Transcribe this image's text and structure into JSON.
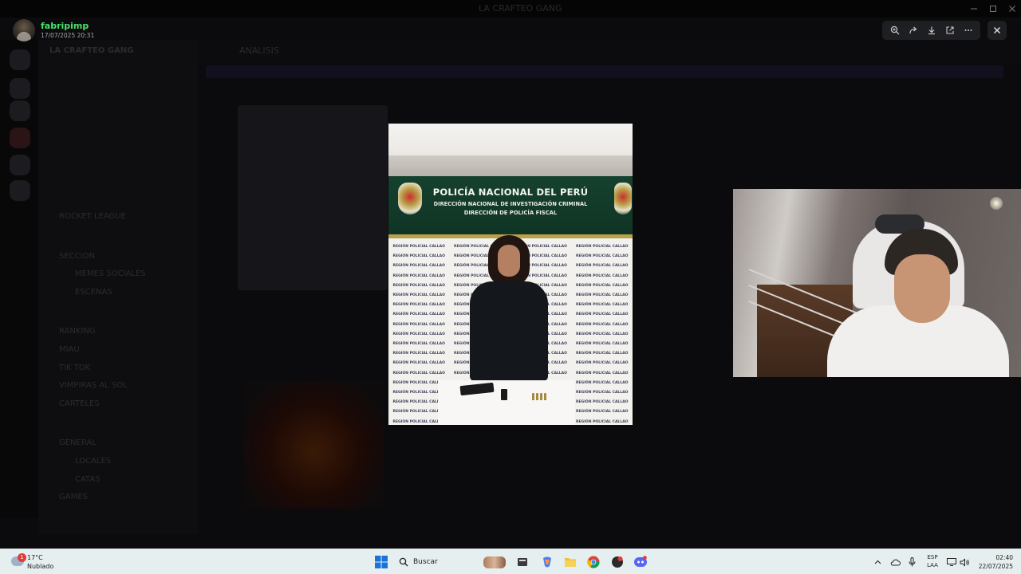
{
  "background_app": {
    "window_title": "LA CRAFTEO GANG",
    "server_name": "LA CRAFTEO GANG",
    "channel_header": "ANALISIS",
    "channels": [
      "ROCKET LEAGUE",
      "SECCION",
      "MEMES SOCIALES",
      "ESCENAS",
      "RANKING",
      "MIAU",
      "TIK TOK",
      "VIMPIRAS AL SOL",
      "CARTELES",
      "GENERAL",
      "LOCALES",
      "CATAS",
      "GAMES"
    ]
  },
  "viewer": {
    "username": "fabripimp",
    "timestamp": "17/07/2025 20:31",
    "toolbar": {
      "zoom_icon": "zoom-in-icon",
      "forward_icon": "forward-icon",
      "download_icon": "download-icon",
      "open_icon": "open-external-icon",
      "more_icon": "more-icon",
      "close_icon": "close-icon"
    }
  },
  "photo": {
    "banner_title": "POLICÍA NACIONAL DEL PERÚ",
    "banner_line2": "DIRECCIÓN NACIONAL DE INVESTIGACIÓN CRIMINAL",
    "banner_line3": "DIRECCIÓN DE POLICÍA FISCAL",
    "backdrop_text": "REGIÓN POLICIAL CALLAO"
  },
  "taskbar": {
    "weather": {
      "temp": "17°C",
      "condition": "Nublado",
      "alert_count": "1"
    },
    "search_placeholder": "Buscar",
    "language": {
      "line1": "ESP",
      "line2": "LAA"
    },
    "clock": {
      "time": "02:40",
      "date": "22/07/2025"
    },
    "apps": [
      "windows-start",
      "search",
      "file-explorer-app",
      "copilot",
      "folder",
      "chrome",
      "app-red",
      "discord"
    ]
  }
}
